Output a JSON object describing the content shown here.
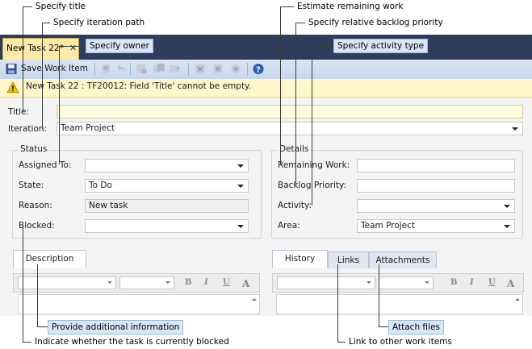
{
  "callouts": {
    "specify_title": "Specify title",
    "specify_iteration_path": "Specify iteration path",
    "specify_owner": "Specify owner",
    "estimate_remaining_work": "Estimate remaining work",
    "specify_backlog_priority": "Specify relative backlog priority",
    "specify_activity_type": "Specify activity type",
    "provide_additional_info": "Provide additional information",
    "indicate_blocked": "Indicate whether the task is currently blocked",
    "link_other_items": "Link to other work items",
    "attach_files": "Attach files"
  },
  "document_tab": {
    "title": "New Task 22*",
    "close": "✕"
  },
  "toolbar": {
    "save_label": "Save Work Item"
  },
  "infobar": {
    "message": "New Task 22 : TF20012: Field 'Title' cannot be empty."
  },
  "form": {
    "title_label": "Title:",
    "title_value": "",
    "iteration_label": "Iteration:",
    "iteration_value": "Team Project",
    "status": {
      "group_label": "Status",
      "assigned_to_label": "Assigned To:",
      "assigned_to_value": "",
      "state_label": "State:",
      "state_value": "To Do",
      "reason_label": "Reason:",
      "reason_value": "New task",
      "blocked_label": "Blocked:",
      "blocked_value": ""
    },
    "details": {
      "group_label": "Details",
      "remaining_work_label": "Remaining Work:",
      "remaining_work_value": "",
      "backlog_priority_label": "Backlog Priority:",
      "backlog_priority_value": "",
      "activity_label": "Activity:",
      "activity_value": "",
      "area_label": "Area:",
      "area_value": "Team Project"
    },
    "left_tabs": [
      {
        "label": "Description",
        "active": true
      }
    ],
    "right_tabs": [
      {
        "label": "History",
        "active": true
      },
      {
        "label": "Links",
        "active": false
      },
      {
        "label": "Attachments",
        "active": false
      }
    ],
    "format_buttons": {
      "bold": "B",
      "italic": "I",
      "underline": "U",
      "font_color": "A"
    }
  },
  "colors": {
    "tabstrip": "#2d3e5c",
    "doc_tab": "#fde9a8",
    "infobar": "#fff7c9",
    "required_field": "#fffbe0",
    "callout_fill": "#d9e6f5"
  }
}
